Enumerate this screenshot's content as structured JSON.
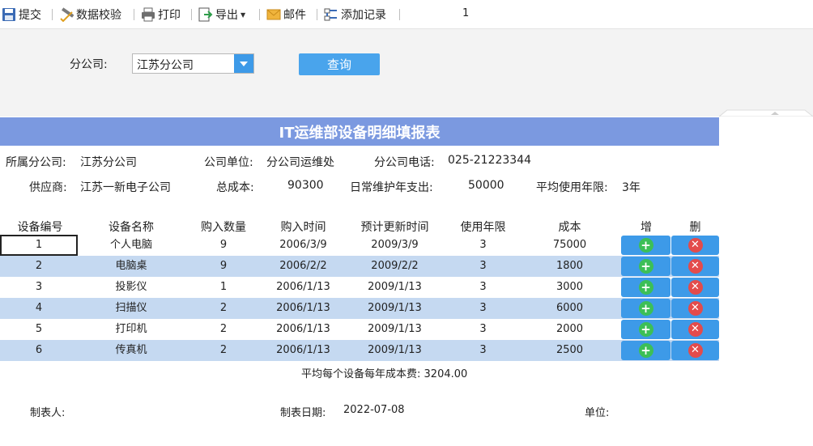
{
  "toolbar": {
    "items": [
      {
        "label": "提交",
        "icon": "save-icon"
      },
      {
        "label": "数据校验",
        "icon": "validate-icon"
      },
      {
        "label": "打印",
        "icon": "printer-icon"
      },
      {
        "label": "导出",
        "icon": "export-icon"
      },
      {
        "label": "邮件",
        "icon": "mail-icon"
      },
      {
        "label": "添加记录",
        "icon": "add-record-icon"
      }
    ],
    "page_number": "1"
  },
  "filter": {
    "label": "分公司:",
    "selected_value": "江苏分公司",
    "query_label": "查询"
  },
  "report": {
    "title": "IT运维部设备明细填报表",
    "info": {
      "branch_label": "所属分公司:",
      "branch_value": "江苏分公司",
      "unit_label": "公司单位:",
      "unit_value": "分公司运维处",
      "phone_label": "分公司电话:",
      "phone_value": "025-21223344",
      "supplier_label": "供应商:",
      "supplier_value": "江苏一新电子公司",
      "total_cost_label": "总成本:",
      "total_cost_value": "90300",
      "maint_label": "日常维护年支出:",
      "maint_value": "50000",
      "avg_years_label": "平均使用年限:",
      "avg_years_value": "3年"
    },
    "columns": [
      "设备编号",
      "设备名称",
      "购入数量",
      "购入时间",
      "预计更新时间",
      "使用年限",
      "成本",
      "增",
      "删"
    ],
    "rows": [
      {
        "id": "1",
        "name": "个人电脑",
        "qty": "9",
        "buy_date": "2006/3/9",
        "update_date": "2009/3/9",
        "years": "3",
        "cost": "75000"
      },
      {
        "id": "2",
        "name": "电脑桌",
        "qty": "9",
        "buy_date": "2006/2/2",
        "update_date": "2009/2/2",
        "years": "3",
        "cost": "1800"
      },
      {
        "id": "3",
        "name": "投影仪",
        "qty": "1",
        "buy_date": "2006/1/13",
        "update_date": "2009/1/13",
        "years": "3",
        "cost": "3000"
      },
      {
        "id": "4",
        "name": "扫描仪",
        "qty": "2",
        "buy_date": "2006/1/13",
        "update_date": "2009/1/13",
        "years": "3",
        "cost": "6000"
      },
      {
        "id": "5",
        "name": "打印机",
        "qty": "2",
        "buy_date": "2006/1/13",
        "update_date": "2009/1/13",
        "years": "3",
        "cost": "2000"
      },
      {
        "id": "6",
        "name": "传真机",
        "qty": "2",
        "buy_date": "2006/1/13",
        "update_date": "2009/1/13",
        "years": "3",
        "cost": "2500"
      }
    ],
    "avg_cost_label": "平均每个设备每年成本费:",
    "avg_cost_value": "3204.00",
    "footer": {
      "maker_label": "制表人:",
      "date_label": "制表日期:",
      "date_value": "2022-07-08",
      "unit_label": "单位:"
    }
  },
  "colors": {
    "title_bar": "#7b99e0",
    "row_alt": "#c5d9f1",
    "button_blue": "#3d9ae8",
    "add_green": "#3cbf57",
    "delete_red": "#e34b4b"
  }
}
